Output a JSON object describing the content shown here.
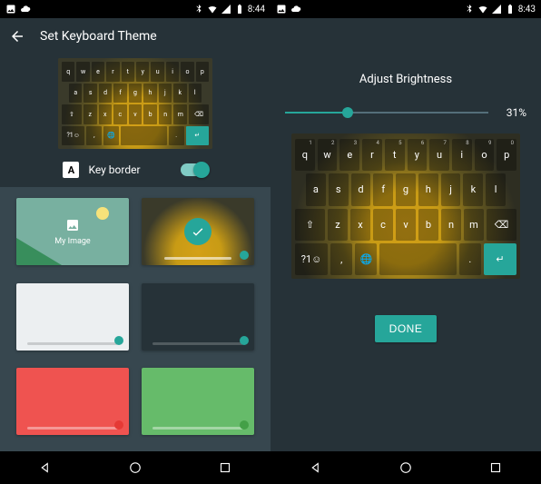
{
  "left": {
    "status": {
      "time": "8:44"
    },
    "header": {
      "title": "Set Keyboard Theme"
    },
    "preview_keys": {
      "r1": [
        "q",
        "w",
        "e",
        "r",
        "t",
        "y",
        "u",
        "i",
        "o",
        "p"
      ],
      "r2": [
        "a",
        "s",
        "d",
        "f",
        "g",
        "h",
        "j",
        "k",
        "l"
      ],
      "r3_shift": "⇧",
      "r3": [
        "z",
        "x",
        "c",
        "v",
        "b",
        "n",
        "m"
      ],
      "r3_del": "⌫",
      "r4_sym": "?1☺",
      "r4_comma": ",",
      "r4_globe": "🌐",
      "r4_space": "",
      "r4_dot": ".",
      "r4_enter": "↵"
    },
    "key_border": {
      "icon_letter": "A",
      "label": "Key border",
      "on": true
    },
    "themes": {
      "myimage_label": "My Image",
      "colors": {
        "teal": "#26a69a",
        "red": "#e53935",
        "green": "#43a047"
      }
    }
  },
  "right": {
    "status": {
      "time": "8:43"
    },
    "brightness": {
      "title": "Adjust Brightness",
      "percent_label": "31%",
      "percent": 31
    },
    "keys": {
      "r1": [
        {
          "l": "q",
          "s": "1"
        },
        {
          "l": "w",
          "s": "2"
        },
        {
          "l": "e",
          "s": "3"
        },
        {
          "l": "r",
          "s": "4"
        },
        {
          "l": "t",
          "s": "5"
        },
        {
          "l": "y",
          "s": "6"
        },
        {
          "l": "u",
          "s": "7"
        },
        {
          "l": "i",
          "s": "8"
        },
        {
          "l": "o",
          "s": "9"
        },
        {
          "l": "p",
          "s": "0"
        }
      ],
      "r2": [
        "a",
        "s",
        "d",
        "f",
        "g",
        "h",
        "j",
        "k",
        "l"
      ],
      "r3_shift": "⇧",
      "r3": [
        "z",
        "x",
        "c",
        "v",
        "b",
        "n",
        "m"
      ],
      "r3_del": "⌫",
      "r4_sym": "?1☺",
      "r4_comma": ",",
      "r4_globe": "🌐",
      "r4_space": "",
      "r4_dot": ".",
      "r4_enter": "↵"
    },
    "done": "DONE"
  }
}
